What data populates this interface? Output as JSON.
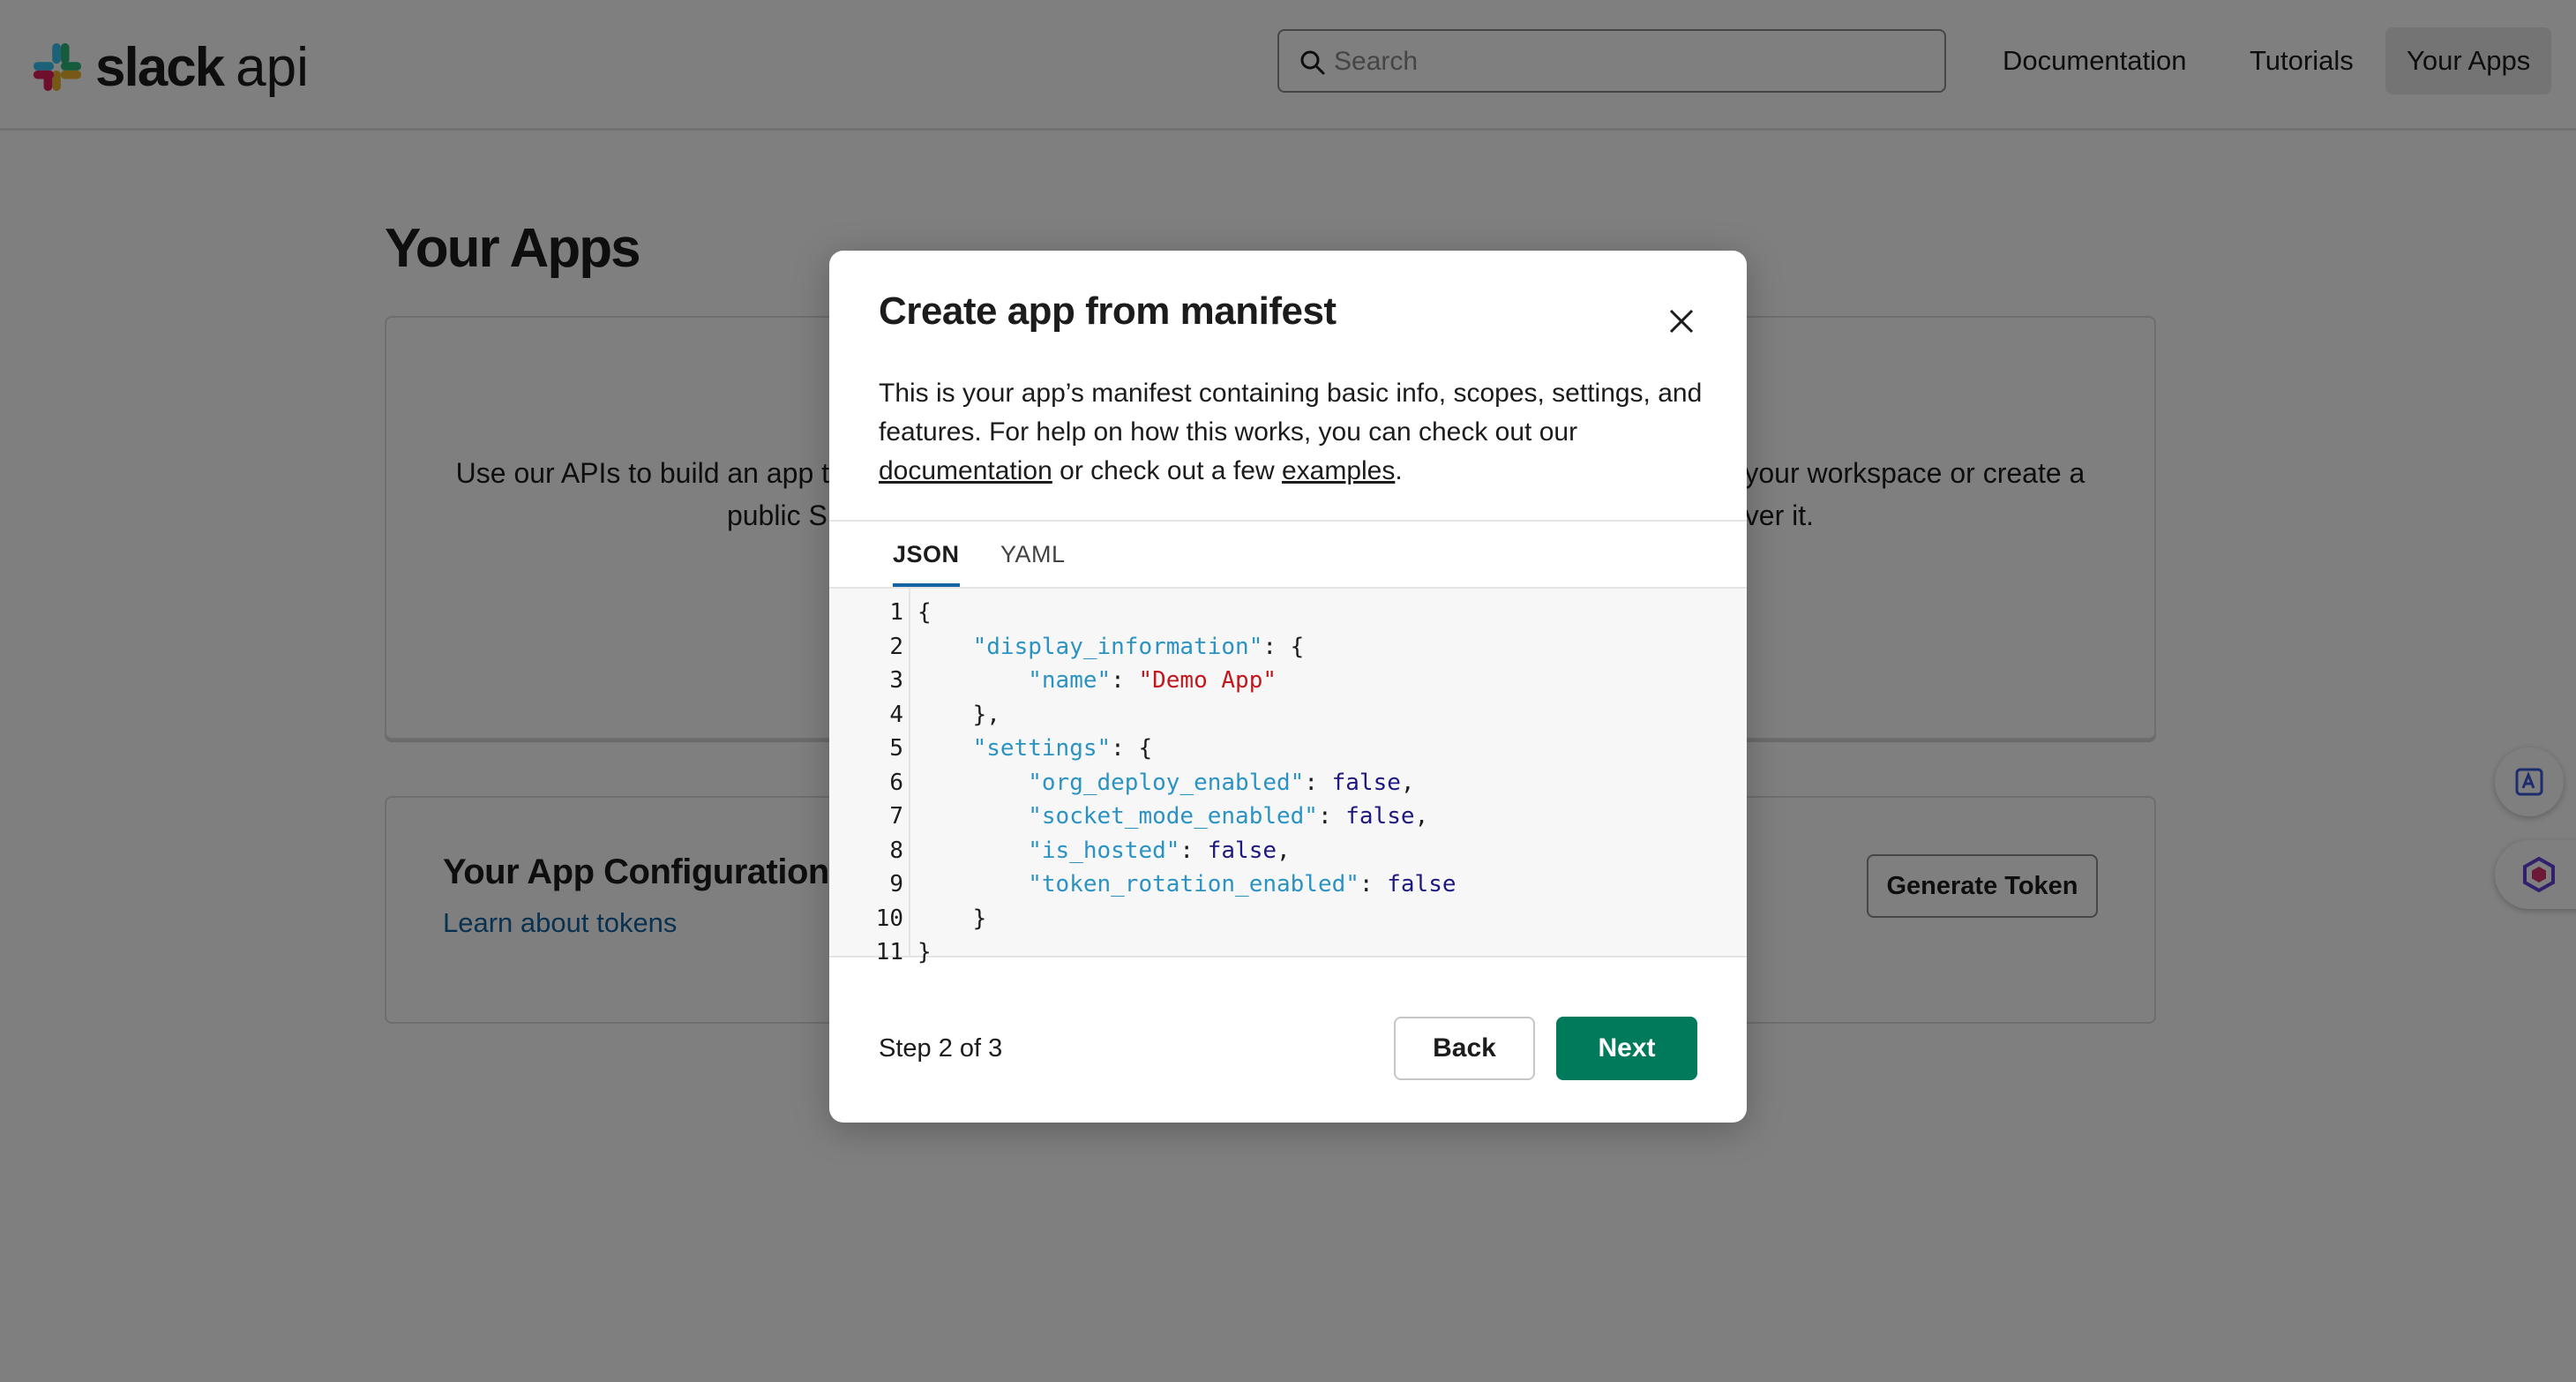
{
  "header": {
    "logo_wordmark": "slack",
    "logo_suffix": "api",
    "search_placeholder": "Search",
    "nav": {
      "documentation": "Documentation",
      "tutorials": "Tutorials",
      "your_apps": "Your Apps"
    },
    "active_nav": "Your Apps"
  },
  "page": {
    "title": "Your Apps",
    "intro_card": {
      "text_left": "Use our APIs to build an app th",
      "text_right": "r your workspace or create a",
      "text_line2_left": "public S",
      "text_line2_right": "ver it."
    },
    "tokens_card": {
      "title": "Your App Configuration T",
      "link": "Learn about tokens",
      "button": "Generate Token"
    }
  },
  "modal": {
    "title": "Create app from manifest",
    "description_part1": "This is your app’s manifest containing basic info, scopes, settings, and features. For help on how this works, you can check out our ",
    "link_documentation": "documentation",
    "description_part2": " or check out a few ",
    "link_examples": "examples",
    "description_part3": ".",
    "tabs": [
      "JSON",
      "YAML"
    ],
    "active_tab": "JSON",
    "code_lines": [
      {
        "n": "1",
        "indent": "",
        "key": "",
        "sep": "",
        "val": "",
        "vtype": "",
        "tail": "{"
      },
      {
        "n": "2",
        "indent": "    ",
        "key": "\"display_information\"",
        "sep": ": ",
        "val": "",
        "vtype": "",
        "tail": "{"
      },
      {
        "n": "3",
        "indent": "        ",
        "key": "\"name\"",
        "sep": ": ",
        "val": "\"Demo App\"",
        "vtype": "s",
        "tail": ""
      },
      {
        "n": "4",
        "indent": "    ",
        "key": "",
        "sep": "",
        "val": "",
        "vtype": "",
        "tail": "},"
      },
      {
        "n": "5",
        "indent": "    ",
        "key": "\"settings\"",
        "sep": ": ",
        "val": "",
        "vtype": "",
        "tail": "{"
      },
      {
        "n": "6",
        "indent": "        ",
        "key": "\"org_deploy_enabled\"",
        "sep": ": ",
        "val": "false",
        "vtype": "b",
        "tail": ","
      },
      {
        "n": "7",
        "indent": "        ",
        "key": "\"socket_mode_enabled\"",
        "sep": ": ",
        "val": "false",
        "vtype": "b",
        "tail": ","
      },
      {
        "n": "8",
        "indent": "        ",
        "key": "\"is_hosted\"",
        "sep": ": ",
        "val": "false",
        "vtype": "b",
        "tail": ","
      },
      {
        "n": "9",
        "indent": "        ",
        "key": "\"token_rotation_enabled\"",
        "sep": ": ",
        "val": "false",
        "vtype": "b",
        "tail": ""
      },
      {
        "n": "10",
        "indent": "    ",
        "key": "",
        "sep": "",
        "val": "",
        "vtype": "",
        "tail": "}"
      },
      {
        "n": "11",
        "indent": "",
        "key": "",
        "sep": "",
        "val": "",
        "vtype": "",
        "tail": "}"
      }
    ],
    "step": "Step 2 of 3",
    "back_label": "Back",
    "next_label": "Next"
  },
  "colors": {
    "primary_green": "#007a5a",
    "link_blue": "#1264a3",
    "json_key": "#2b93c4",
    "json_string": "#c2171c",
    "json_bool": "#1e1980"
  },
  "icons": {
    "logo": "slack-logo-icon",
    "search": "search-icon",
    "close": "close-icon",
    "side_1": "translate-icon",
    "side_2": "assistant-icon"
  }
}
